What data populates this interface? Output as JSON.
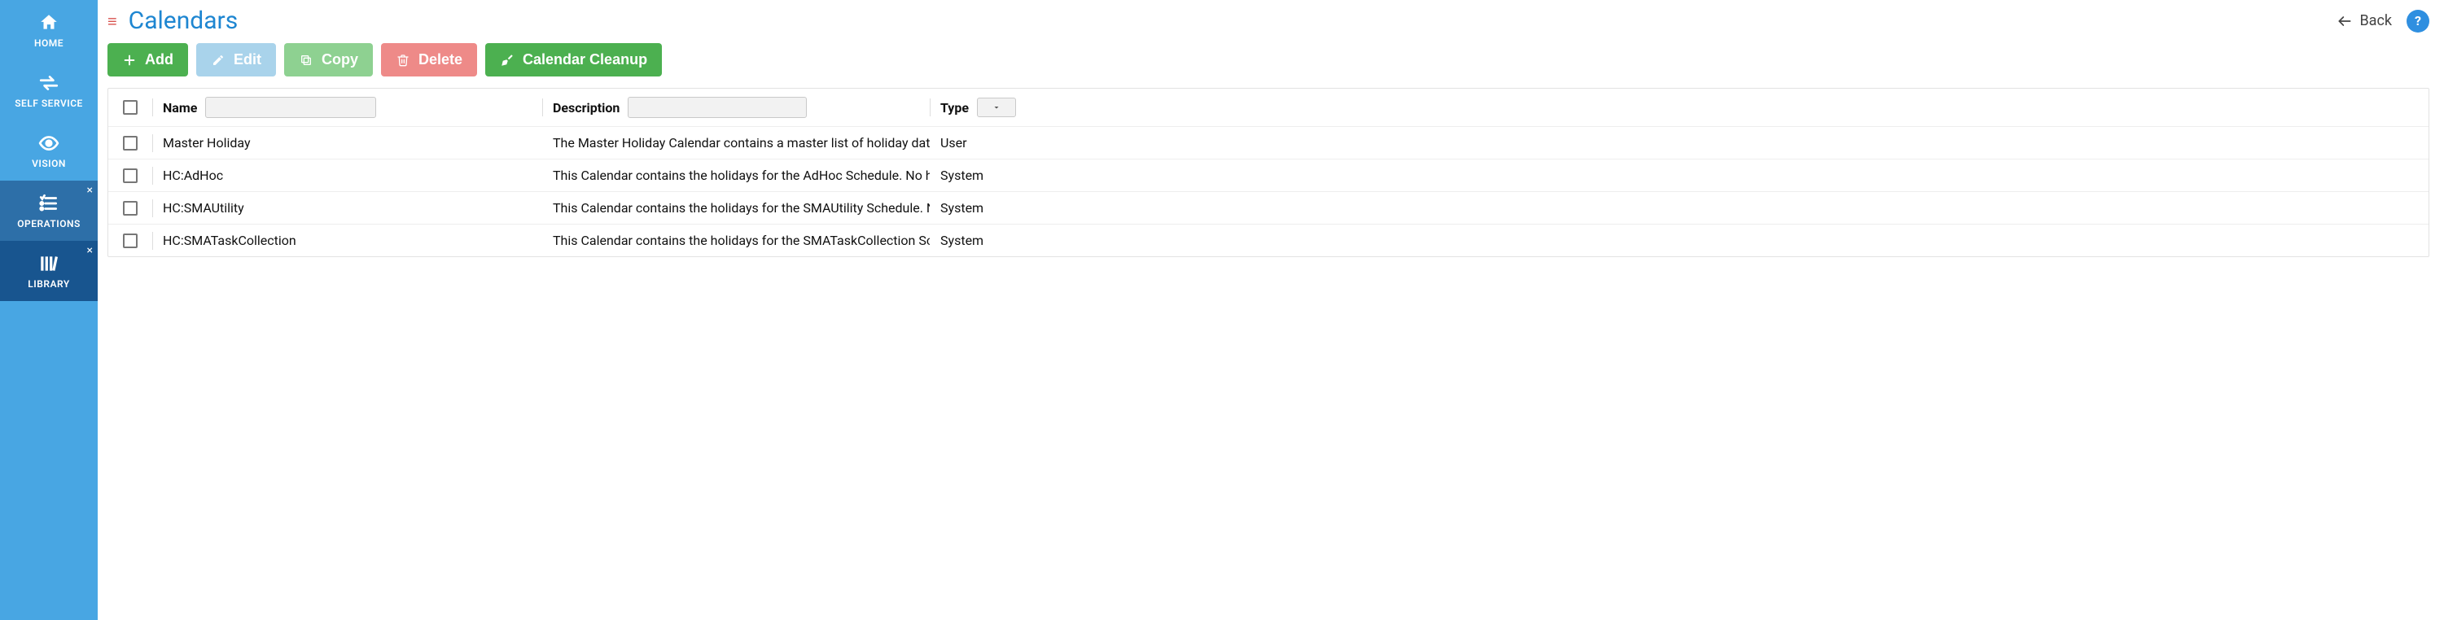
{
  "sidebar": {
    "items": [
      {
        "label": "HOME"
      },
      {
        "label": "SELF SERVICE"
      },
      {
        "label": "VISION"
      },
      {
        "label": "OPERATIONS"
      },
      {
        "label": "LIBRARY"
      }
    ]
  },
  "header": {
    "title": "Calendars",
    "back_label": "Back",
    "help_label": "?"
  },
  "toolbar": {
    "add": "Add",
    "edit": "Edit",
    "copy": "Copy",
    "delete": "Delete",
    "cleanup": "Calendar Cleanup"
  },
  "grid": {
    "columns": {
      "name": "Name",
      "description": "Description",
      "type": "Type"
    },
    "rows": [
      {
        "name": "Master Holiday",
        "description": "The Master Holiday Calendar contains a master list of holiday dat…",
        "type": "User"
      },
      {
        "name": "HC:AdHoc",
        "description": "This Calendar contains the holidays for the AdHoc Schedule. No h…",
        "type": "System"
      },
      {
        "name": "HC:SMAUtility",
        "description": "This Calendar contains the holidays for the SMAUtility Schedule. N…",
        "type": "System"
      },
      {
        "name": "HC:SMATaskCollection",
        "description": "This Calendar contains the holidays for the SMATaskCollection Sc…",
        "type": "System"
      }
    ]
  }
}
